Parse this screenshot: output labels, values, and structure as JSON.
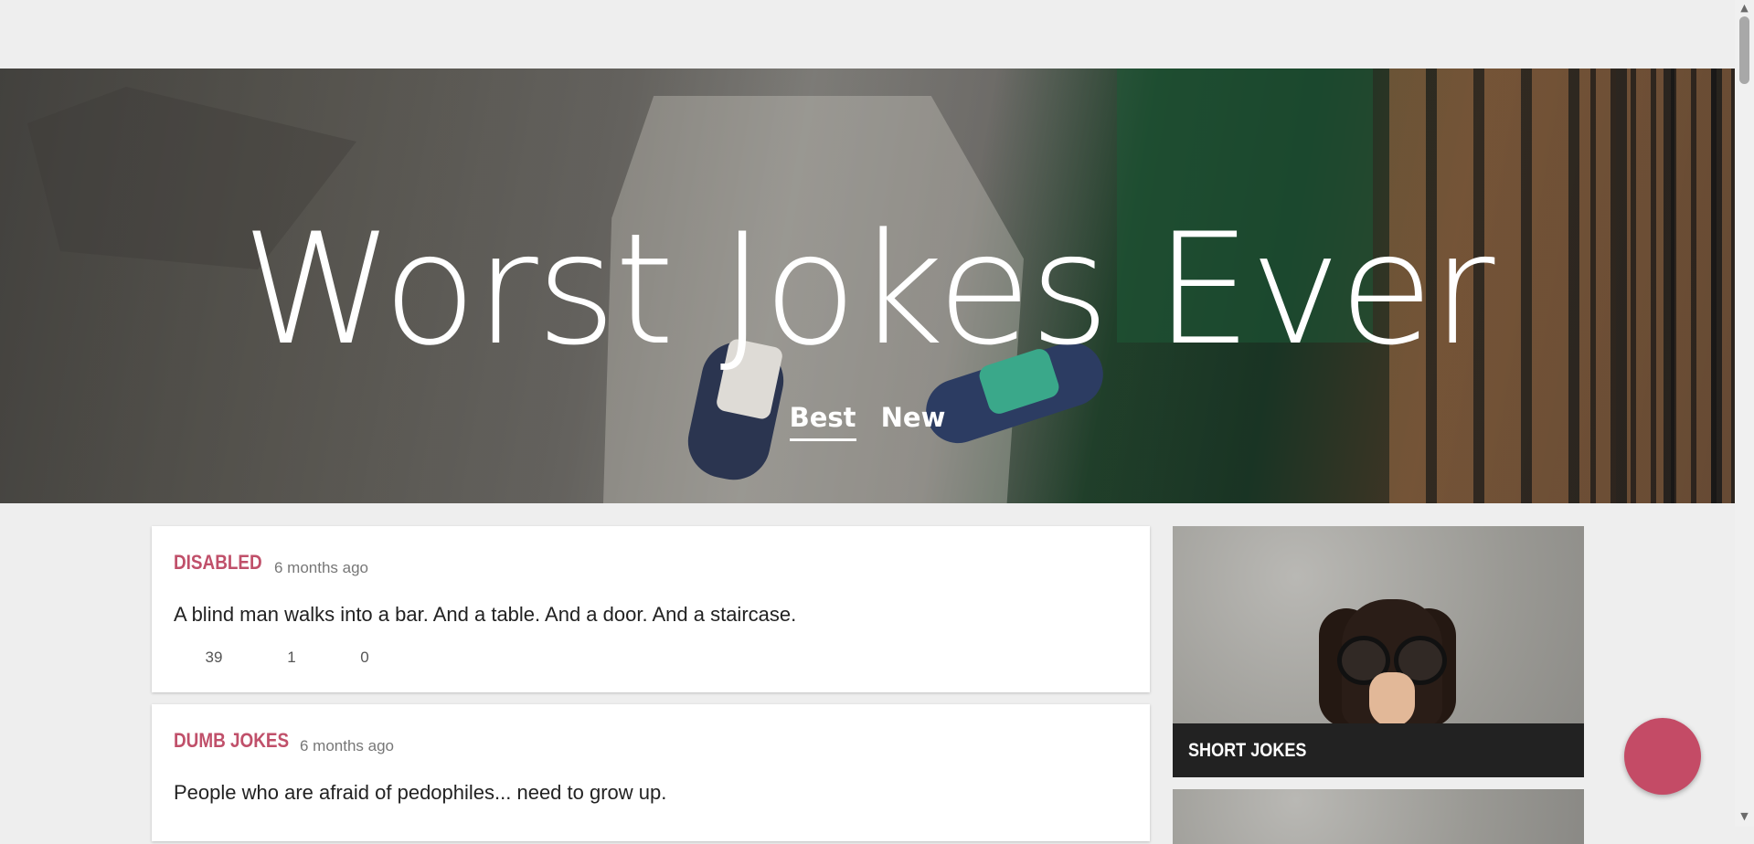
{
  "hero": {
    "title": "Worst Jokes Ever",
    "tabs": [
      {
        "label": "Best",
        "active": true
      },
      {
        "label": "New",
        "active": false
      }
    ]
  },
  "posts": [
    {
      "category": "DISABLED",
      "time": "6 months ago",
      "text": "A blind man walks into a bar. And a table. And a door. And a staircase.",
      "stats": [
        "39",
        "1",
        "0"
      ]
    },
    {
      "category": "DUMB JOKES",
      "time": "6 months ago",
      "text": "People who are afraid of pedophiles... need to grow up."
    }
  ],
  "sidebar": {
    "tiles": [
      {
        "label": "SHORT JOKES"
      },
      {
        "label": ""
      }
    ]
  },
  "colors": {
    "accent": "#c0506a",
    "fab": "#c44b66",
    "background": "#eeeeee",
    "tile_label_bg": "#222222"
  }
}
